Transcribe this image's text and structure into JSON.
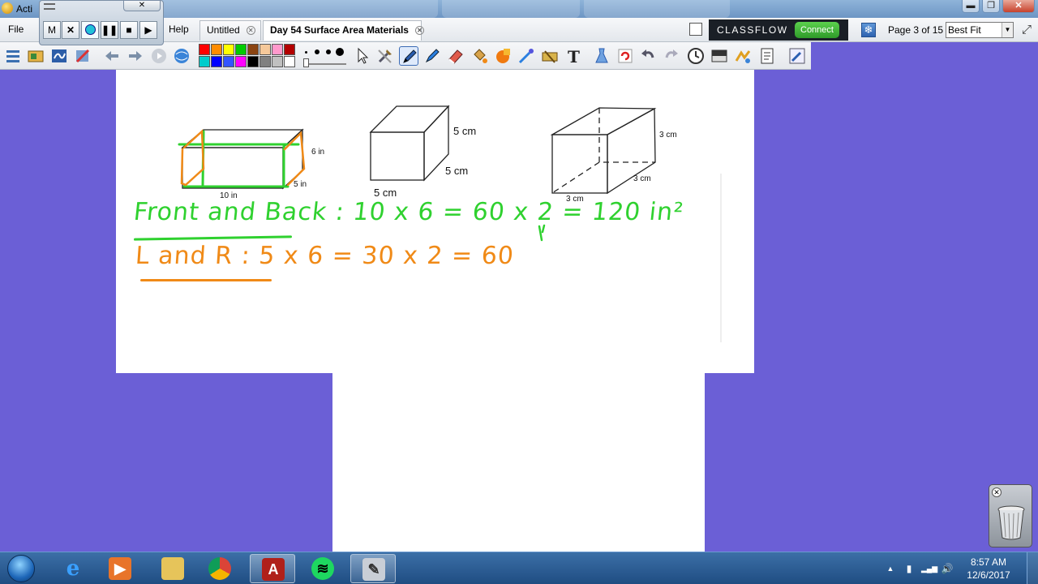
{
  "window": {
    "title": "Acti",
    "controls": {
      "minimize": "▬",
      "maximize": "❐",
      "close": "✕"
    }
  },
  "menu": {
    "file": "File",
    "help": "Help"
  },
  "recorder": {
    "close": "✕",
    "buttons": {
      "m": "M",
      "x": "✕",
      "pause": "❚❚",
      "stop": "■",
      "play": "▶"
    }
  },
  "tabs": [
    {
      "label": "Untitled",
      "close": "✕"
    },
    {
      "label": "Day 54 Surface Area Materials",
      "close": "✕"
    }
  ],
  "classflow": {
    "label": "CLASSFLOW",
    "connect": "Connect"
  },
  "navigation": {
    "page_indicator": "Page 3 of 15",
    "zoom": "Best Fit",
    "zoom_arrow": "▼"
  },
  "palette": {
    "colors": [
      "#ff0000",
      "#ff8c00",
      "#ffff00",
      "#00cc00",
      "#8b4513",
      "#f5c89a",
      "#ff99cc",
      "#b30000",
      "#00cccc",
      "#0000ff",
      "#3355ff",
      "#ff00ff",
      "#000000",
      "#808080",
      "#c0c0c0",
      "#ffffff"
    ]
  },
  "canvas": {
    "figure1": {
      "height": "6 in",
      "depth": "5 in",
      "length": "10 in"
    },
    "figure2": {
      "top": "5 cm",
      "side": "5 cm",
      "bottom": "5 cm"
    },
    "figure3": {
      "height": "3 cm",
      "depth": "3 cm",
      "width": "3 cm"
    },
    "ink_green": "Front and Back : 10 x 6 = 60 x 2 = 120 in²",
    "ink_orange": "L and R : 5 x 6 = 30 x 2 = 60",
    "colors": {
      "green_ink": "#2fd12f",
      "orange_ink": "#f08a17"
    }
  },
  "trash": {
    "close": "✕"
  },
  "taskbar": {
    "clock_time": "8:57 AM",
    "clock_date": "12/6/2017",
    "tray": {
      "up_arrow": "▲",
      "network": "▮",
      "signal": "▂▄▆",
      "volume": "🔊"
    }
  },
  "colors": {
    "background": "#6b5fd6",
    "classflow_bg": "#1a1f26",
    "connect_green": "#3fb435"
  }
}
